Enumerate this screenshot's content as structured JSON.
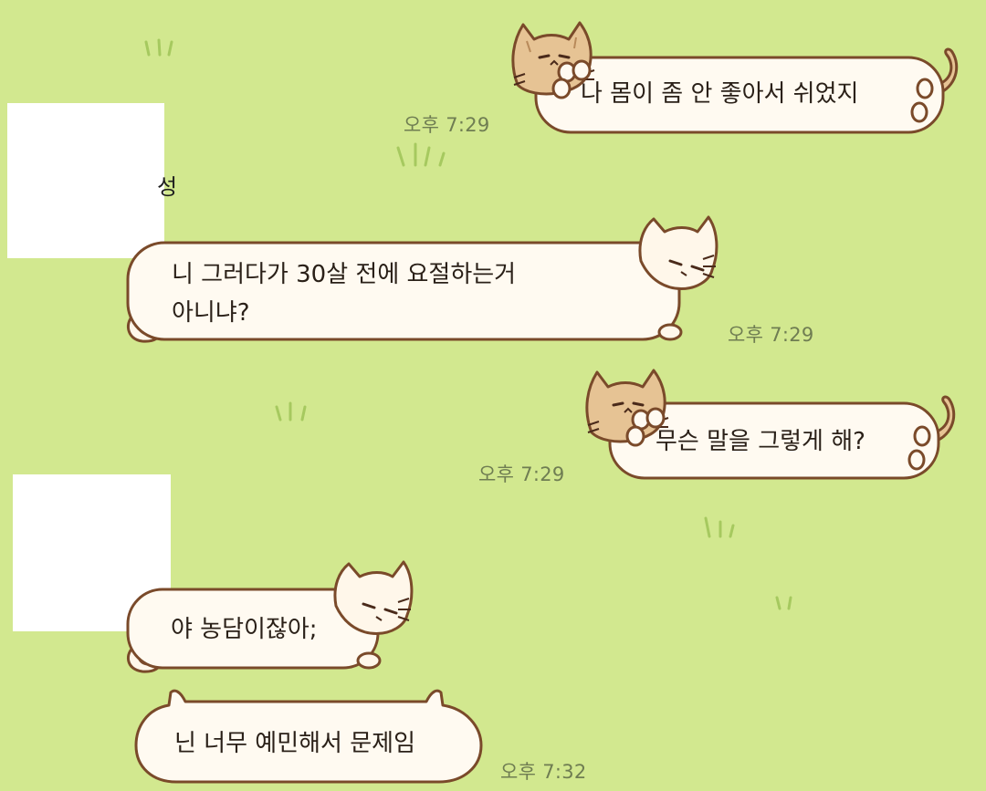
{
  "colors": {
    "background": "#d2e88f",
    "bubble_fill": "#fffaf1",
    "bubble_outline": "#7a4a2a",
    "tan_cat": "#e6c394",
    "cream_cat": "#fff7ea",
    "timestamp": "#6f7d52",
    "grass": "#a6c95f"
  },
  "partner": {
    "name_fragment": "성"
  },
  "messages": [
    {
      "side": "sent",
      "cat": "tan",
      "text": "나 몸이 좀 안 좋아서 쉬었지",
      "time": "오후 7:29"
    },
    {
      "side": "received",
      "cat": "cream",
      "text_lines": [
        "니 그러다가 30살 전에 요절하는거",
        "아니냐?"
      ],
      "time": "오후 7:29"
    },
    {
      "side": "sent",
      "cat": "tan",
      "text": "무슨 말을 그렇게 해?",
      "time": "오후 7:29"
    },
    {
      "side": "received",
      "cat": "cream",
      "text": "야 농담이잖아;",
      "time": ""
    },
    {
      "side": "received",
      "cat": "cream-ears",
      "text": "닌 너무 예민해서 문제임",
      "time": "오후 7:32"
    }
  ]
}
